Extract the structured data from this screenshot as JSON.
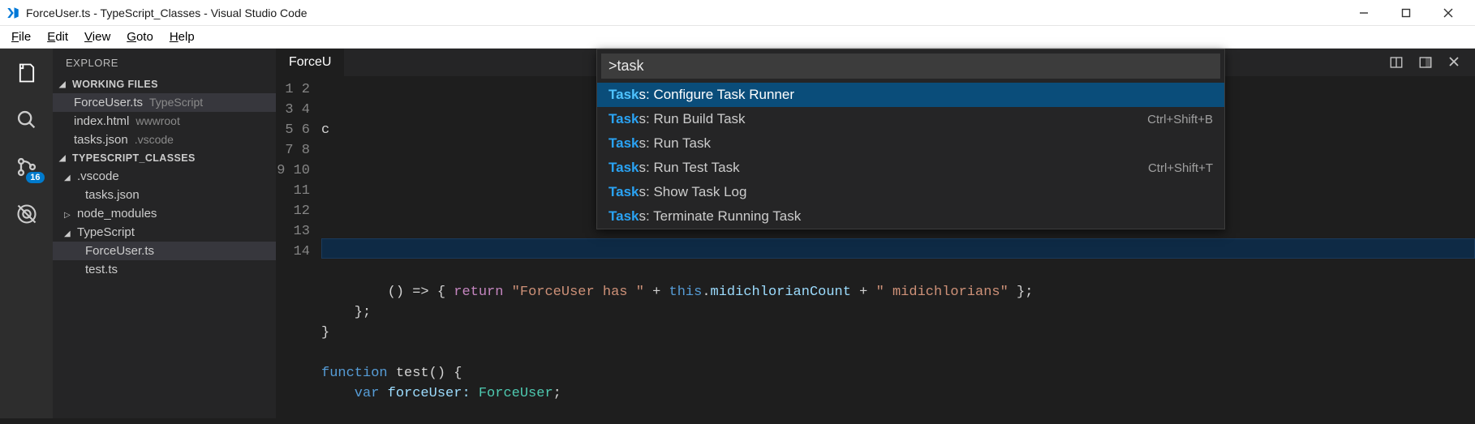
{
  "window": {
    "title": "ForceUser.ts - TypeScript_Classes - Visual Studio Code"
  },
  "menubar": {
    "items": [
      {
        "label": "File",
        "accel": "F"
      },
      {
        "label": "Edit",
        "accel": "E"
      },
      {
        "label": "View",
        "accel": "V"
      },
      {
        "label": "Goto",
        "accel": "G"
      },
      {
        "label": "Help",
        "accel": "H"
      }
    ]
  },
  "activitybar": {
    "git_badge": "16"
  },
  "sidebar": {
    "title": "EXPLORE",
    "working_files": {
      "header": "WORKING FILES",
      "items": [
        {
          "name": "ForceUser.ts",
          "desc": "TypeScript",
          "selected": true
        },
        {
          "name": "index.html",
          "desc": "wwwroot",
          "selected": false
        },
        {
          "name": "tasks.json",
          "desc": ".vscode",
          "selected": false
        }
      ]
    },
    "folder": {
      "header": "TYPESCRIPT_CLASSES",
      "tree": [
        {
          "kind": "folder",
          "name": ".vscode",
          "expanded": true
        },
        {
          "kind": "file",
          "name": "tasks.json",
          "nested": true
        },
        {
          "kind": "folder",
          "name": "node_modules",
          "expanded": false
        },
        {
          "kind": "folder",
          "name": "TypeScript",
          "expanded": true
        },
        {
          "kind": "file",
          "name": "ForceUser.ts",
          "nested": true,
          "selected": true
        },
        {
          "kind": "file",
          "name": "test.ts",
          "nested": true
        }
      ]
    }
  },
  "editor": {
    "tab_label": "ForceU",
    "line_start": 1,
    "line_count": 14,
    "highlight_line": 9,
    "visible_code": {
      "l1": "c",
      "l9_part1": "() => { ",
      "l9_return": "return",
      "l9_str1": "\"ForceUser has \"",
      "l9_plus1": " + ",
      "l9_this": "this",
      "l9_dot": ".",
      "l9_prop": "midichlorianCount",
      "l9_plus2": " + ",
      "l9_str2": "\" midichlorians\"",
      "l9_end": " };",
      "l10": "    };",
      "l11": "}",
      "l12": "",
      "l13_fn": "function",
      "l13_rest": " test() {",
      "l14_var": "    var",
      "l14_name": " forceUser: ",
      "l14_type": "ForceUser",
      "l14_semi": ";"
    }
  },
  "palette": {
    "input_value": ">task",
    "match_text": "Task",
    "items": [
      {
        "rest": "s: Configure Task Runner",
        "shortcut": "",
        "selected": true
      },
      {
        "rest": "s: Run Build Task",
        "shortcut": "Ctrl+Shift+B",
        "selected": false
      },
      {
        "rest": "s: Run Task",
        "shortcut": "",
        "selected": false
      },
      {
        "rest": "s: Run Test Task",
        "shortcut": "Ctrl+Shift+T",
        "selected": false
      },
      {
        "rest": "s: Show Task Log",
        "shortcut": "",
        "selected": false
      },
      {
        "rest": "s: Terminate Running Task",
        "shortcut": "",
        "selected": false
      }
    ]
  }
}
